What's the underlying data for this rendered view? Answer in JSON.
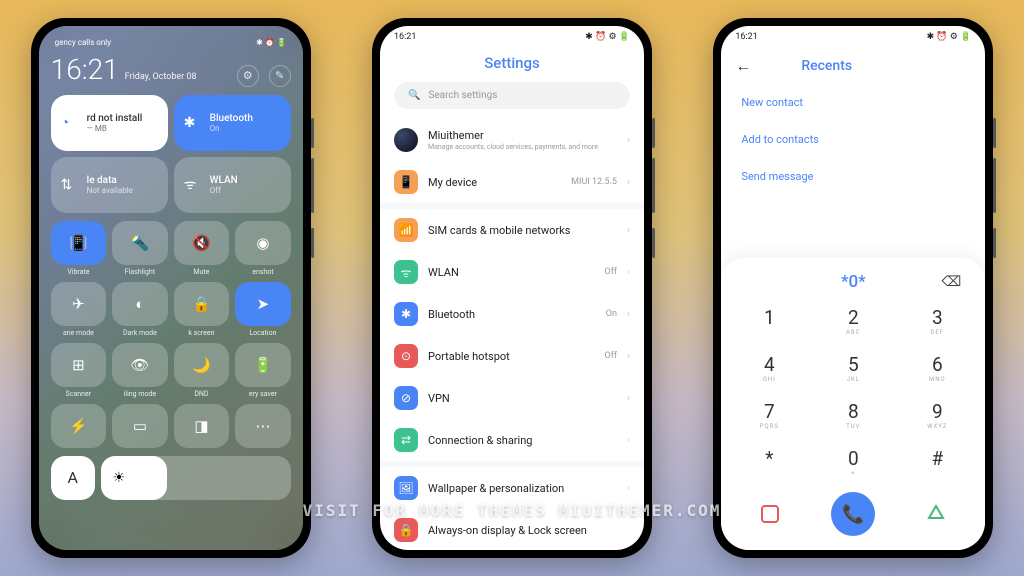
{
  "watermark": "VISIT FOR MORE THEMES  MIUITHEMER.COM",
  "phone1": {
    "status_left": "gency calls only",
    "time": "16:21",
    "date": "Friday, October 08",
    "tiles": {
      "t1": {
        "title": "rd not install",
        "sub": "— MB"
      },
      "t2": {
        "title": "Bluetooth",
        "sub": "On"
      },
      "t3": {
        "title": "le data",
        "sub": "Not available"
      },
      "t4": {
        "title": "WLAN",
        "sub": "Off"
      }
    },
    "small": [
      {
        "label": "Vibrate"
      },
      {
        "label": "Flashlight"
      },
      {
        "label": "Mute"
      },
      {
        "label": "enshot"
      },
      {
        "label": "ane mode"
      },
      {
        "label": "Dark mode"
      },
      {
        "label": "k screen"
      },
      {
        "label": "Location"
      },
      {
        "label": "Scanner"
      },
      {
        "label": "iling mode"
      },
      {
        "label": "DND"
      },
      {
        "label": "ery saver"
      }
    ]
  },
  "phone2": {
    "time": "16:21",
    "title": "Settings",
    "search_placeholder": "Search settings",
    "account": {
      "name": "Miuithemer",
      "desc": "Manage accounts, cloud services, payments, and more"
    },
    "mydevice": {
      "label": "My device",
      "value": "MIUI 12.5.5"
    },
    "items": [
      {
        "label": "SIM cards & mobile networks",
        "value": "",
        "color": "#f5a055",
        "ico": "📶"
      },
      {
        "label": "WLAN",
        "value": "Off",
        "color": "#3cc28f",
        "ico": "ᯤ"
      },
      {
        "label": "Bluetooth",
        "value": "On",
        "color": "#4a85f5",
        "ico": "✱"
      },
      {
        "label": "Portable hotspot",
        "value": "Off",
        "color": "#e85a5a",
        "ico": "⊙"
      },
      {
        "label": "VPN",
        "value": "",
        "color": "#4a85f5",
        "ico": "⊘"
      },
      {
        "label": "Connection & sharing",
        "value": "",
        "color": "#3cc28f",
        "ico": "⇄"
      }
    ],
    "wallpaper": "Wallpaper & personalization",
    "aod": "Always-on display & Lock screen"
  },
  "phone3": {
    "time": "16:21",
    "title": "Recents",
    "links": [
      "New contact",
      "Add to contacts",
      "Send message"
    ],
    "display": "*0*",
    "keys": [
      {
        "n": "1",
        "s": ""
      },
      {
        "n": "2",
        "s": "ABC"
      },
      {
        "n": "3",
        "s": "DEF"
      },
      {
        "n": "4",
        "s": "GHI"
      },
      {
        "n": "5",
        "s": "JKL"
      },
      {
        "n": "6",
        "s": "MNO"
      },
      {
        "n": "7",
        "s": "PQRS"
      },
      {
        "n": "8",
        "s": "TUV"
      },
      {
        "n": "9",
        "s": "WXYZ"
      },
      {
        "n": "*",
        "s": ""
      },
      {
        "n": "0",
        "s": "+"
      },
      {
        "n": "#",
        "s": ""
      }
    ]
  }
}
